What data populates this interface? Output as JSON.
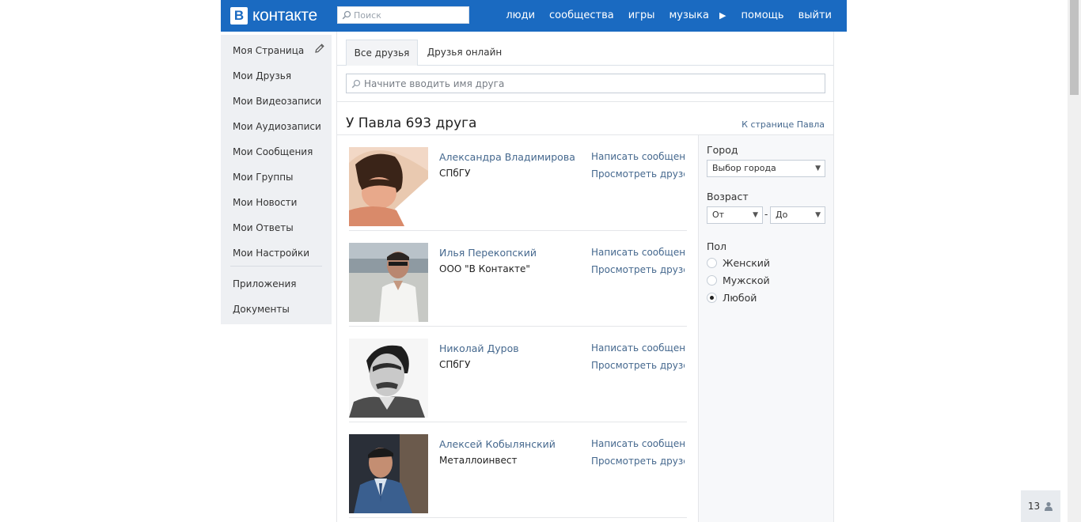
{
  "header": {
    "logo_mark": "B",
    "logo_text": "контакте",
    "search_placeholder": "Поиск",
    "nav": [
      "люди",
      "сообщества",
      "игры",
      "музыка",
      "помощь",
      "выйти"
    ],
    "brand_color": "#1a6ac1"
  },
  "sidebar": {
    "items": [
      {
        "label": "Моя Страница"
      },
      {
        "label": "Мои Друзья"
      },
      {
        "label": "Мои Видеозаписи"
      },
      {
        "label": "Мои Аудиозаписи"
      },
      {
        "label": "Мои Сообщения"
      },
      {
        "label": "Мои Группы"
      },
      {
        "label": "Мои Новости"
      },
      {
        "label": "Мои Ответы"
      },
      {
        "label": "Мои Настройки"
      },
      {
        "label": "Приложения"
      },
      {
        "label": "Документы"
      }
    ],
    "edit_icon": "pencil-icon"
  },
  "tabs": [
    {
      "label": "Все друзья",
      "active": true
    },
    {
      "label": "Друзья онлайн",
      "active": false
    }
  ],
  "friend_search": {
    "placeholder": "Начните вводить имя друга"
  },
  "friends": {
    "title": "У Павла 693 друга",
    "to_page_link": "К странице Павла",
    "list": [
      {
        "name": "Александра Владимирова",
        "org": "СПбГУ",
        "action_message": "Написать сообщение",
        "action_view": "Просмотреть друзей"
      },
      {
        "name": "Илья Перекопский",
        "org": "ООО \"В Контакте\"",
        "action_message": "Написать сообщение",
        "action_view": "Просмотреть друзей"
      },
      {
        "name": "Николай Дуров",
        "org": "СПбГУ",
        "action_message": "Написать сообщение",
        "action_view": "Просмотреть друзей"
      },
      {
        "name": "Алексей Кобылянский",
        "org": "Металлоинвест",
        "action_message": "Написать сообщение",
        "action_view": "Просмотреть друзей"
      }
    ]
  },
  "filters": {
    "city_label": "Город",
    "city_value": "Выбор города",
    "age_label": "Возраст",
    "age_from": "От",
    "age_to": "До",
    "age_dash": "-",
    "gender_label": "Пол",
    "gender_options": [
      {
        "label": "Женский",
        "checked": false
      },
      {
        "label": "Мужской",
        "checked": false
      },
      {
        "label": "Любой",
        "checked": true
      }
    ]
  },
  "counter": {
    "value": "13",
    "icon": "user-icon"
  }
}
